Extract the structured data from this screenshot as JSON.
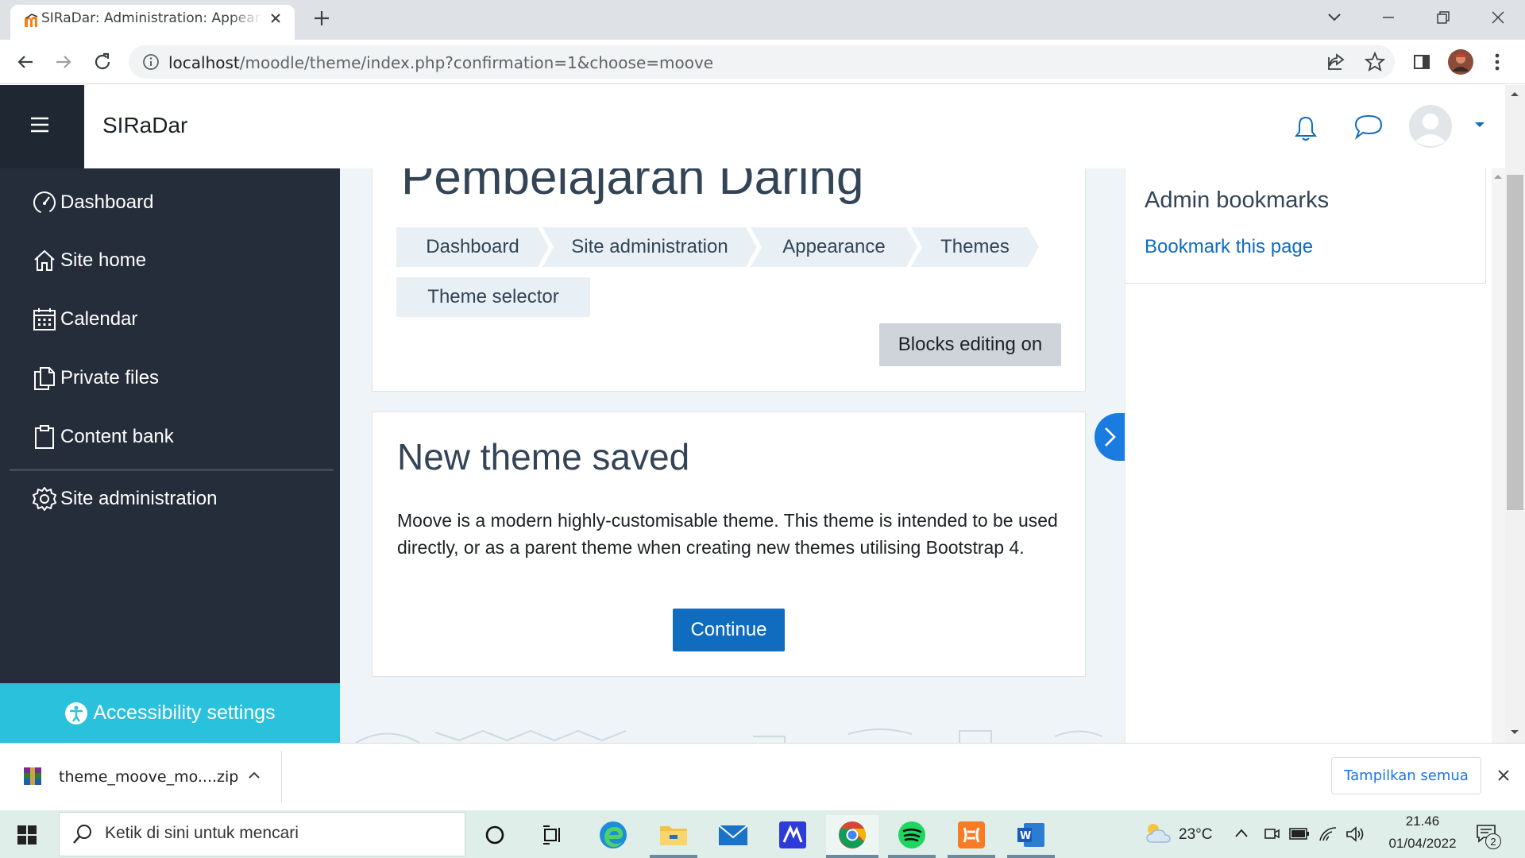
{
  "browser": {
    "tab_title": "SIRaDar: Administration: Appearance",
    "url_host": "localhost",
    "url_path": "/moodle/theme/index.php?confirmation=1&choose=moove"
  },
  "navbar": {
    "brand": "SIRaDar"
  },
  "drawer": {
    "items": [
      {
        "label": "Dashboard",
        "icon": "dashboard-gauge-icon"
      },
      {
        "label": "Site home",
        "icon": "home-icon"
      },
      {
        "label": "Calendar",
        "icon": "calendar-icon"
      },
      {
        "label": "Private files",
        "icon": "files-icon"
      },
      {
        "label": "Content bank",
        "icon": "clipboard-icon"
      },
      {
        "label": "Site administration",
        "icon": "gear-icon"
      }
    ],
    "accessibility_label": "Accessibility settings"
  },
  "page": {
    "heading": "Pembelajaran Daring",
    "breadcrumbs": [
      "Dashboard",
      "Site administration",
      "Appearance",
      "Themes",
      "Theme selector"
    ],
    "blocks_editing_label": "Blocks editing on",
    "notice_title": "New theme saved",
    "notice_text": "Moove is a modern highly-customisable theme. This theme is intended to be used directly, or as a parent theme when creating new themes utilising Bootstrap 4.",
    "continue_label": "Continue"
  },
  "blocks": {
    "admin_bookmarks_title": "Admin bookmarks",
    "bookmark_link": "Bookmark this page"
  },
  "downloads": {
    "file_name": "theme_moove_mo....zip",
    "show_all_label": "Tampilkan semua"
  },
  "taskbar": {
    "search_placeholder": "Ketik di sini untuk mencari",
    "temperature": "23°C",
    "time": "21.46",
    "date": "01/04/2022",
    "notification_count": "2"
  },
  "colors": {
    "drawer_bg": "#252d3a",
    "accessibility_bg": "#2ac1dc",
    "primary": "#0f6cbf",
    "page_bg": "#eef4f7"
  }
}
